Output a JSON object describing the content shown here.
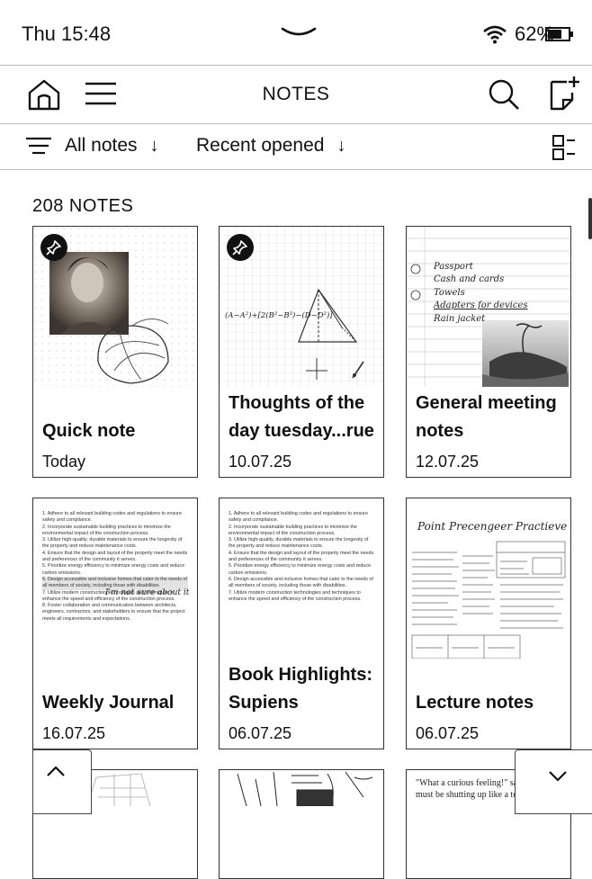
{
  "status": {
    "time": "Thu 15:48",
    "battery": "62%"
  },
  "appbar": {
    "title": "NOTES"
  },
  "filters": {
    "category": "All notes",
    "sort": "Recent opened"
  },
  "notes_count": "208 NOTES",
  "notes": [
    {
      "title_line1": "Quick note",
      "title_line2": "",
      "date": "Today",
      "pinned": true
    },
    {
      "title_line1": "Thoughts of the",
      "title_line2": "day tuesday...rue",
      "date": "10.07.25",
      "pinned": true
    },
    {
      "title_line1": "General meeting",
      "title_line2": "notes",
      "date": "12.07.25",
      "pinned": false
    },
    {
      "title_line1": "Weekly Journal",
      "title_line2": "",
      "date": "16.07.25",
      "pinned": false
    },
    {
      "title_line1": "Book Highlights:",
      "title_line2": "Supiens",
      "date": "06.07.25",
      "pinned": false
    },
    {
      "title_line1": "Lecture notes",
      "title_line2": "",
      "date": "06.07.25",
      "pinned": false
    }
  ],
  "handwriting": {
    "math": "(A−A²)+[2(B²−B³)−(D−D²)]",
    "list": [
      "Passport",
      "Cash and cards",
      "Towels",
      "Adapters for devices",
      "Rain jacket"
    ],
    "lecture_title": "Point Precengeer Practieve",
    "journal_note": "I'm not sure about it"
  },
  "doc_lines": [
    "1. Adhere to all relevant building codes and regulations to ensure safety and compliance.",
    "2. Incorporate sustainable building practices to minimize the environmental impact of the construction process.",
    "3. Utilize high-quality, durable materials to ensure the longevity of the property and reduce maintenance costs.",
    "4. Ensure that the design and layout of the property meet the needs and preferences of the community it serves.",
    "5. Prioritize energy efficiency to minimize energy costs and reduce carbon emissions.",
    "6. Design accessible and inclusive homes that cater to the needs of all members of society, including those with disabilities.",
    "7. Utilize modern construction technologies and techniques to enhance the speed and efficiency of the construction process.",
    "8. Foster collaboration and communication between architects, engineers, contractors, and stakeholders to ensure that the project meets all requirements and expectations."
  ],
  "story_snippet": "\"What a curious feeling!\" said Alice. I must be shutting up like a telescope.",
  "icons": [
    "home-icon",
    "menu-icon",
    "search-icon",
    "new-note-icon",
    "sort-lines-icon",
    "view-toggle-icon",
    "pin-icon",
    "wifi-icon",
    "battery-icon",
    "chevron-up-icon",
    "chevron-down-icon"
  ]
}
